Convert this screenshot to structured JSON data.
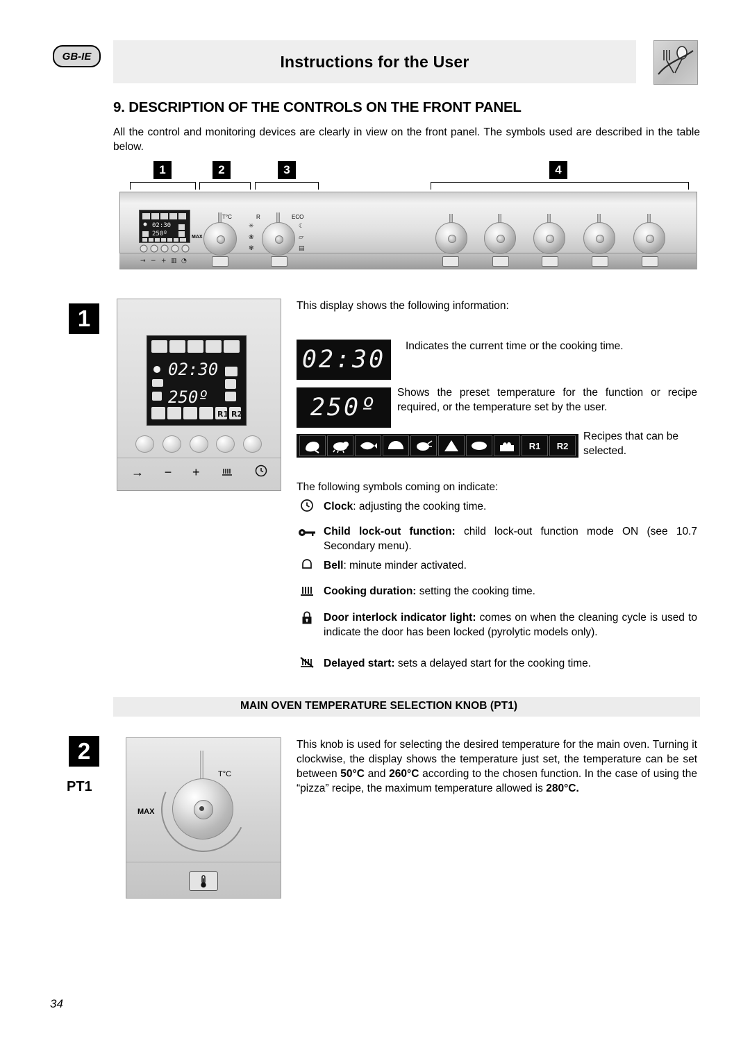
{
  "header": {
    "lang_badge": "GB-IE",
    "title": "Instructions for the User",
    "icon": "cutlery-icon"
  },
  "section": {
    "title": "9. DESCRIPTION OF THE CONTROLS ON THE FRONT PANEL",
    "intro": "All the control and monitoring devices are clearly in view on the front panel. The symbols used are described in the table below."
  },
  "callouts": {
    "top": [
      "1",
      "2",
      "3",
      "4"
    ],
    "item1": "1",
    "item2": "2",
    "pt1_label": "PT1"
  },
  "display": {
    "intro": "This display shows the following information:",
    "time_desc": "Indicates the current time or the cooking time.",
    "temp_desc": "Shows the preset temperature for the function or recipe required, or the temperature set by the user.",
    "recipes_desc": "Recipes that can be selected.",
    "lcd_time": "02:30",
    "lcd_temp": "250°",
    "recipe_cells": [
      "chicken-icon",
      "pig-icon",
      "fish-icon",
      "bread-icon",
      "turkey-icon",
      "pizza-icon",
      "pie-icon",
      "cake-icon",
      "R1",
      "R2"
    ],
    "symbols_intro": "The following symbols coming on indicate:"
  },
  "symbols": [
    {
      "glyph": "clock-icon",
      "bold": "Clock",
      "text": ": adjusting the cooking time."
    },
    {
      "glyph": "key-icon",
      "bold": "Child lock-out function:",
      "text": " child lock-out function mode ON (see 10.7 Secondary menu)."
    },
    {
      "glyph": "bell-icon",
      "bold": "Bell",
      "text": ": minute minder activated."
    },
    {
      "glyph": "cooking-duration-icon",
      "bold": "Cooking duration:",
      "text": " setting the cooking time."
    },
    {
      "glyph": "padlock-icon",
      "bold": "Door interlock indicator light:",
      "text": " comes on when the cleaning cycle is used to indicate the door has been locked (pyrolytic models only)."
    },
    {
      "glyph": "delayed-start-icon",
      "bold": "Delayed start:",
      "text": " sets a delayed start for the cooking time."
    }
  ],
  "knob_section": {
    "heading": "MAIN OVEN TEMPERATURE SELECTION KNOB (PT1)",
    "body_part1": "This knob is used for selecting the desired temperature for the main oven. Turning it clockwise, the display shows the temperature just set, the temperature can be set between ",
    "temp_min": "50°C",
    "body_part2": " and ",
    "temp_max": "260°C",
    "body_part3": " according to the chosen function. In the case of using the “pizza” recipe, the maximum temperature allowed is ",
    "temp_pizza": "280°C.",
    "knob_label_t": "T°C",
    "knob_label_max": "MAX"
  },
  "clock_module": {
    "lcd_time": "02:30",
    "lcd_temp": "250º",
    "buttons": [
      "button-1",
      "button-2",
      "button-3",
      "button-4",
      "button-5"
    ],
    "bottom_symbols": [
      "arrow-right-icon",
      "minus-icon",
      "plus-icon",
      "cooking-duration-icon",
      "clock-icon"
    ]
  },
  "panel_graphic": {
    "labels": {
      "temp": "T°C",
      "max": "MAX",
      "r": "R",
      "eco": "ECO"
    }
  },
  "footer": {
    "page_number": "34"
  },
  "colors": {
    "header_bg": "#eeeeee",
    "subhead_bg": "#ececec",
    "lcd_bg": "#0d0d0d",
    "accent": "#000000"
  }
}
